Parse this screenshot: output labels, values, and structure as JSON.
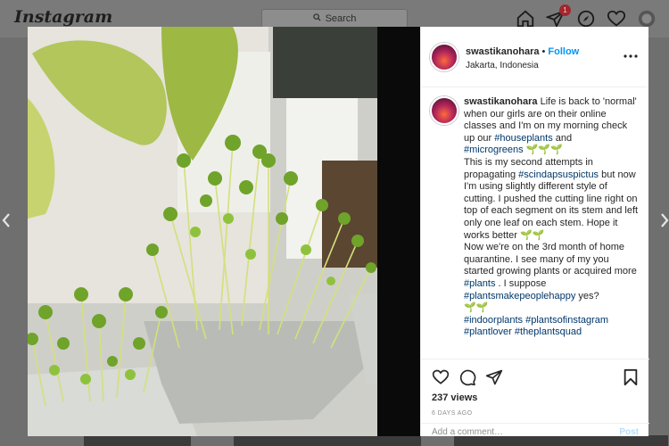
{
  "topbar": {
    "logo": "Instagram",
    "search_placeholder": "Search",
    "notification_count": "1"
  },
  "post": {
    "username": "swastikanohara",
    "separator": "•",
    "follow_label": "Follow",
    "location": "Jakarta, Indonesia",
    "caption": {
      "t1": " Life is back to 'normal' when our girls are on their online classes and I'm on my morning check up our ",
      "h1": "#houseplants",
      "t2": " and ",
      "h2": "#microgreens",
      "t3": "This is my second attempts in propagating ",
      "h3": "#scindapsuspictus",
      "t4": " but now I'm using slightly different style of cutting. I pushed the cutting line right on top of each segment on its stem and left only one leaf on each stem. Hope it works better ",
      "t5": "Now we're on the 3rd month of home quarantine. I see many of my you started growing plants or acquired more ",
      "h4": "#plants",
      "t6": " . I suppose ",
      "h5": "#plantsmakepeoplehappy",
      "t7": " yes?",
      "h6": "#indoorplants",
      "h7": "#plantsofinstagram",
      "h8": "#plantlover",
      "h9": "#theplantsquad"
    },
    "views": "237 views",
    "date": "6 DAYS AGO",
    "comment_placeholder": "Add a comment…",
    "post_label": "Post"
  },
  "icons": {
    "search": "search-icon",
    "home": "home-icon",
    "direct": "paper-plane-icon",
    "explore": "compass-icon",
    "activity": "heart-icon",
    "profile": "avatar",
    "like": "heart-icon",
    "comment": "comment-icon",
    "share": "paper-plane-icon",
    "save": "bookmark-icon",
    "prev": "chevron-left-icon",
    "next": "chevron-right-icon"
  },
  "colors": {
    "accent": "#0095f6",
    "hashtag": "#00376b",
    "badge": "#ed4956"
  }
}
